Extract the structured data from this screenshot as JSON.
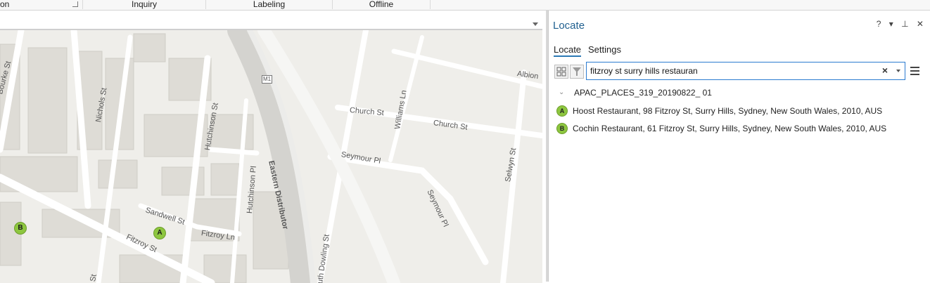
{
  "ribbon": {
    "groups": [
      {
        "label": "on"
      },
      {
        "label": "Inquiry"
      },
      {
        "label": "Labeling"
      },
      {
        "label": "Offline"
      }
    ]
  },
  "map": {
    "street_labels": [
      "Bourke St",
      "Nichols St",
      "Hutchinson St",
      "Hutchinson Pl",
      "Eastern Distributor",
      "M1",
      "Sandwell St",
      "Fitzroy Ln",
      "Fitzroy St",
      "Church St",
      "Church St",
      "Williams Ln",
      "Seymour Pl",
      "Seymour Pl",
      "Selwyn St",
      "Albion",
      "uth Dowling St",
      "St"
    ],
    "markers": [
      {
        "label": "A"
      },
      {
        "label": "B"
      }
    ]
  },
  "pane": {
    "title": "Locate",
    "controls": "? ▾ ⊥ ✕",
    "tabs": [
      {
        "label": "Locate"
      },
      {
        "label": "Settings"
      }
    ],
    "search": {
      "value": "fitzroy st surry hills restauran"
    },
    "group": {
      "label": "APAC_PLACES_319_20190822_ 01"
    },
    "results": [
      {
        "marker": "A",
        "text": "Hoost Restaurant, 98 Fitzroy St, Surry Hills, Sydney, New South Wales, 2010, AUS"
      },
      {
        "marker": "B",
        "text": "Cochin Restaurant, 61 Fitzroy St, Surry Hills, Sydney, New South Wales, 2010, AUS"
      }
    ]
  },
  "colors": {
    "accent": "#2b79b5",
    "marker": "#8dc63f",
    "map_bg": "#efeeea"
  }
}
